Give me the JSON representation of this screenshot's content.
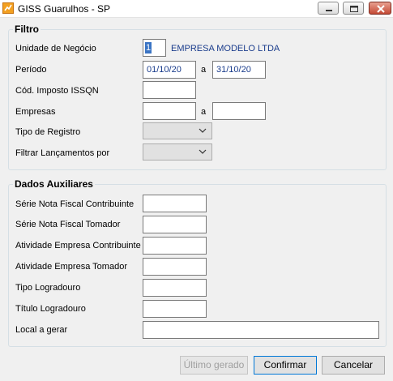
{
  "window": {
    "title": "GISS Guarulhos - SP"
  },
  "filtro": {
    "title": "Filtro",
    "unidade_label": "Unidade de Negócio",
    "unidade_code": "1",
    "unidade_name": "EMPRESA MODELO LTDA",
    "periodo_label": "Período",
    "periodo_start": "01/10/20",
    "periodo_sep": "a",
    "periodo_end": "31/10/20",
    "cod_imposto_label": "Cód. Imposto ISSQN",
    "cod_imposto_value": "",
    "empresas_label": "Empresas",
    "empresas_sep": "a",
    "empresas_start": "",
    "empresas_end": "",
    "tipo_registro_label": "Tipo de Registro",
    "tipo_registro_value": "",
    "filtrar_label": "Filtrar Lançamentos por",
    "filtrar_value": ""
  },
  "auxiliares": {
    "title": "Dados Auxiliares",
    "serie_contrib_label": "Série Nota Fiscal Contribuinte",
    "serie_tomador_label": "Série Nota Fiscal Tomador",
    "ativ_contrib_label": "Atividade Empresa Contribuinte",
    "ativ_tomador_label": "Atividade Empresa Tomador",
    "tipo_logradouro_label": "Tipo Logradouro",
    "titulo_logradouro_label": "Título Logradouro",
    "local_gerar_label": "Local a gerar",
    "serie_contrib_value": "",
    "serie_tomador_value": "",
    "ativ_contrib_value": "",
    "ativ_tomador_value": "",
    "tipo_logradouro_value": "",
    "titulo_logradouro_value": "",
    "local_gerar_value": ""
  },
  "buttons": {
    "ultimo_gerado": "Último gerado",
    "confirmar": "Confirmar",
    "cancelar": "Cancelar"
  },
  "colors": {
    "link_text": "#1a3c8c",
    "close_button": "#c44a35",
    "selection": "#3a74c4"
  },
  "icons": {
    "app": "giss-app-icon",
    "minimize": "minimize-icon",
    "maximize": "maximize-icon",
    "close": "close-icon",
    "dropdown": "chevron-down-icon"
  }
}
